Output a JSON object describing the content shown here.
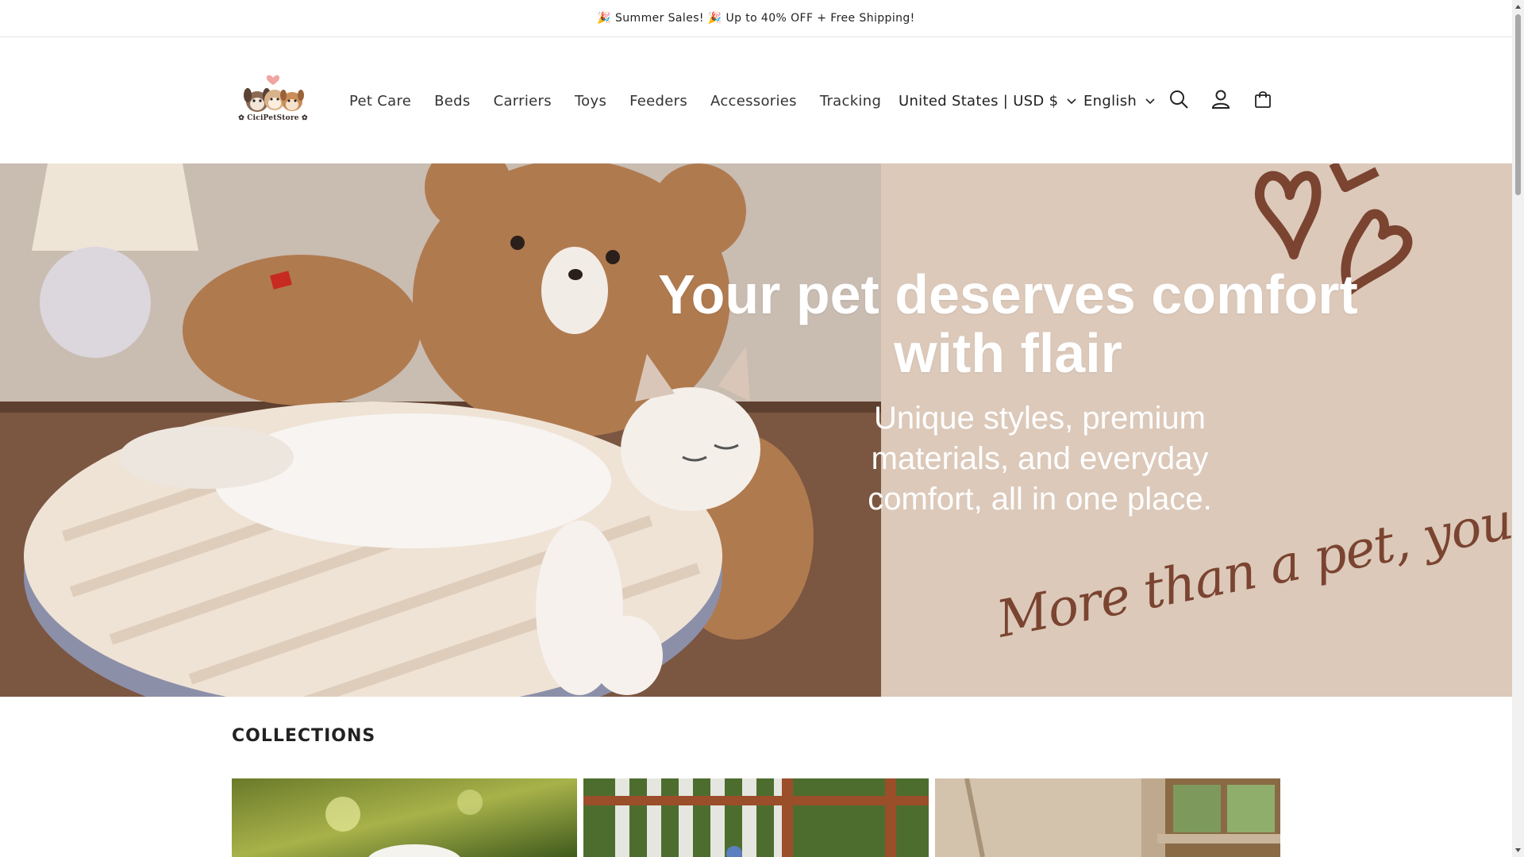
{
  "announcement": {
    "text": "🎉 Summer Sales! 🎉 Up to 40% OFF + Free Shipping!"
  },
  "header": {
    "logo_text": "✿ CiciPetStore ✿",
    "nav": [
      "Pet Care",
      "Beds",
      "Carriers",
      "Toys",
      "Feeders",
      "Accessories",
      "Tracking"
    ],
    "country_currency": "United States | USD $",
    "language": "English",
    "icons": [
      "search-icon",
      "account-icon",
      "cart-icon"
    ]
  },
  "hero": {
    "title": "Your pet deserves comfort with flair",
    "subtitle": "Unique styles, premium materials, and everyday comfort, all in one place.",
    "script_text": "More than a pet, you're family"
  },
  "collections": {
    "heading": "COLLECTIONS"
  },
  "colors": {
    "hero_background": "#dcc9ba",
    "script_brown": "#7a4430",
    "text": "#222222"
  }
}
